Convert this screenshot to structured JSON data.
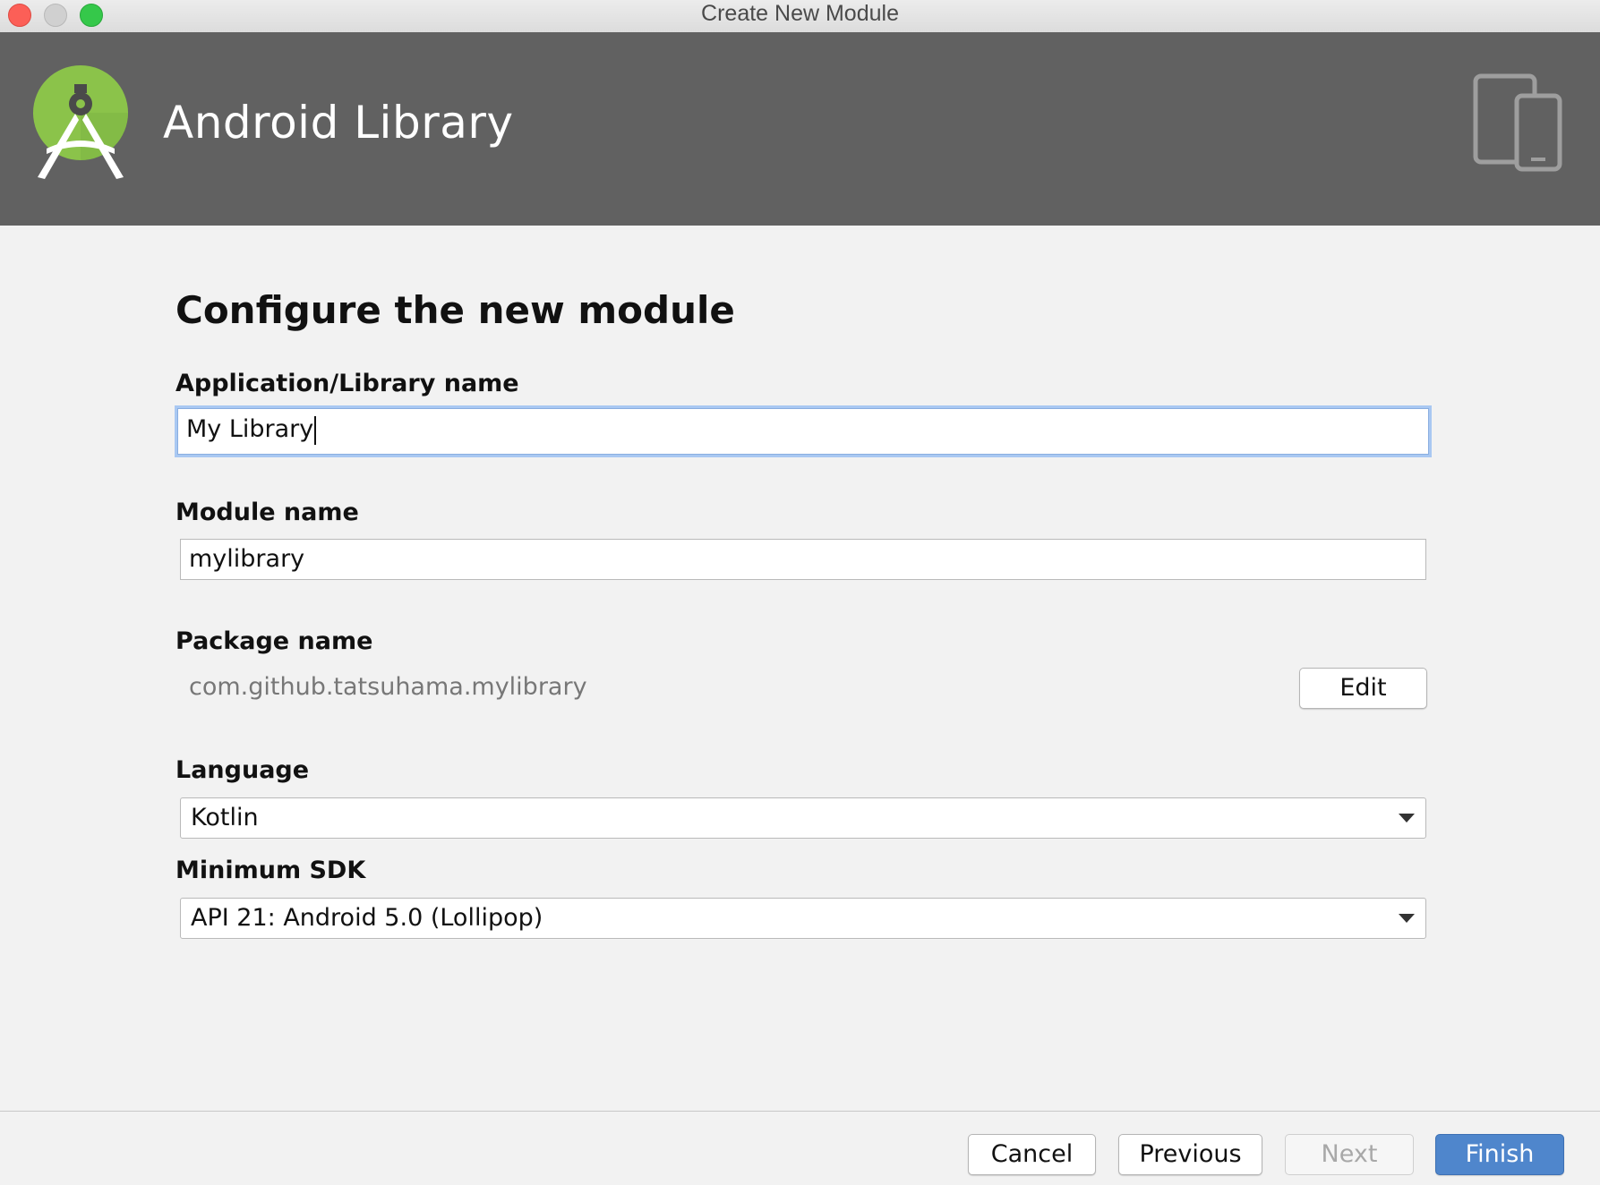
{
  "window": {
    "title": "Create New Module"
  },
  "header": {
    "title": "Android Library",
    "logo_icon": "android-studio-icon",
    "device_icon": "tablet-phone-icon"
  },
  "form": {
    "heading": "Configure the new module",
    "app_name": {
      "label": "Application/Library name",
      "value": "My Library"
    },
    "module_name": {
      "label": "Module name",
      "value": "mylibrary"
    },
    "package_name": {
      "label": "Package name",
      "value": "com.github.tatsuhama.mylibrary",
      "edit_label": "Edit"
    },
    "language": {
      "label": "Language",
      "selected": "Kotlin"
    },
    "min_sdk": {
      "label": "Minimum SDK",
      "selected": "API 21: Android 5.0 (Lollipop)"
    }
  },
  "footer": {
    "cancel": "Cancel",
    "previous": "Previous",
    "next": "Next",
    "finish": "Finish"
  },
  "colors": {
    "header_bg": "#616161",
    "primary_button": "#4f86cc",
    "focus_ring": "#a9c8f2",
    "logo_green": "#8bc34a"
  }
}
